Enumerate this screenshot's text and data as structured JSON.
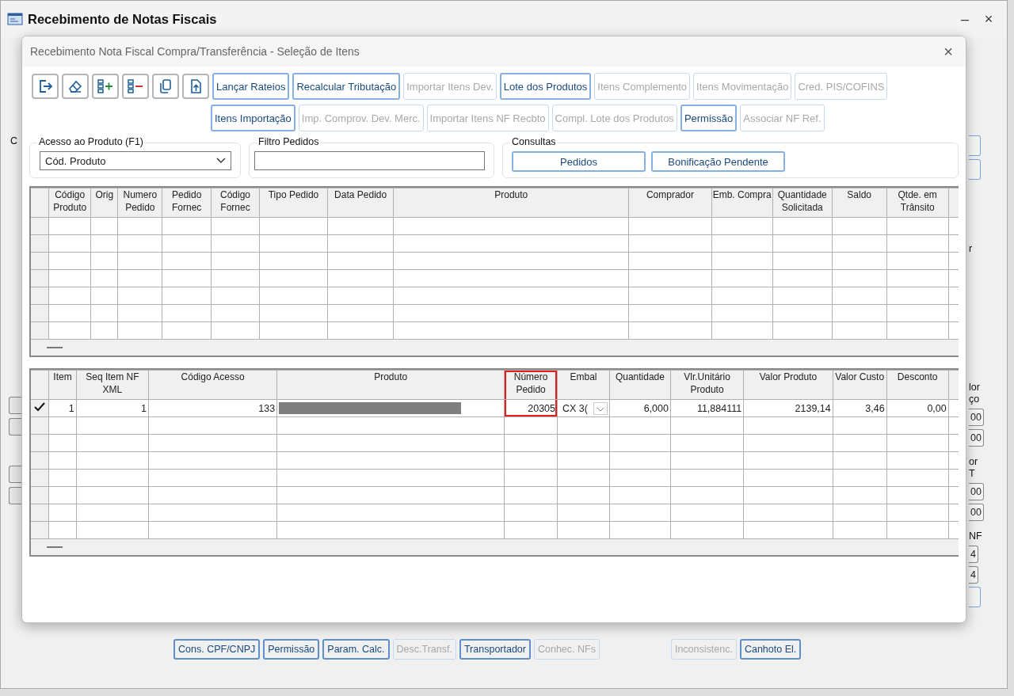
{
  "main_window": {
    "title": "Recebimento de Notas Fiscais",
    "controls": [
      "–",
      "×"
    ]
  },
  "background_left_label": "C",
  "background_right_fragments": [
    {
      "kind": "label",
      "text": "r"
    },
    {
      "kind": "label",
      "text": "lor"
    },
    {
      "kind": "label",
      "text": "ço"
    },
    {
      "kind": "field",
      "text": "00"
    },
    {
      "kind": "field",
      "text": "00"
    },
    {
      "kind": "label",
      "text": "or"
    },
    {
      "kind": "label",
      "text": "T"
    },
    {
      "kind": "field",
      "text": "00"
    },
    {
      "kind": "field",
      "text": "00"
    },
    {
      "kind": "label",
      "text": "NF"
    },
    {
      "kind": "field",
      "text": "4"
    },
    {
      "kind": "field",
      "text": "4"
    }
  ],
  "background_buttons_left": [
    {
      "label": "Cons. CPF/CNPJ",
      "disabled": false
    },
    {
      "label": "Permissão",
      "disabled": false
    },
    {
      "label": "Param. Calc.",
      "disabled": false
    },
    {
      "label": "Desc.Transf.",
      "disabled": true
    },
    {
      "label": "Transportador",
      "disabled": false
    },
    {
      "label": "Conhec. NFs",
      "disabled": true
    }
  ],
  "background_buttons_right": [
    {
      "label": "Inconsistenc.",
      "disabled": true
    },
    {
      "label": "Canhoto El.",
      "disabled": false
    }
  ],
  "dialog": {
    "title": "Recebimento Nota Fiscal Compra/Transferência - Seleção de Itens",
    "close": "×",
    "icon_buttons": [
      {
        "kind": "exit"
      },
      {
        "kind": "eraser"
      },
      {
        "kind": "add-row"
      },
      {
        "kind": "remove-row"
      },
      {
        "kind": "copy"
      },
      {
        "kind": "upload"
      }
    ],
    "toolbar_row_1": [
      {
        "label": "Lançar Rateios",
        "disabled": false
      },
      {
        "label": "Recalcular Tributação",
        "disabled": false
      },
      {
        "label": "Importar Itens Dev.",
        "disabled": true
      },
      {
        "label": "Lote dos Produtos",
        "disabled": false
      },
      {
        "label": "Itens Complemento",
        "disabled": true
      },
      {
        "label": "Itens Movimentação",
        "disabled": true
      },
      {
        "label": "Cred. PIS/COFINS",
        "disabled": true
      }
    ],
    "toolbar_row_2": [
      {
        "label": "Itens Importação",
        "disabled": false
      },
      {
        "label": "Imp. Comprov. Dev. Merc.",
        "disabled": true
      },
      {
        "label": "Importar Itens NF Recbto",
        "disabled": true
      },
      {
        "label": "Compl. Lote dos Produtos",
        "disabled": true
      },
      {
        "label": "Permissão",
        "disabled": false
      },
      {
        "label": "Associar NF Ref.",
        "disabled": true
      }
    ],
    "product_access": {
      "legend": "Acesso ao Produto (F1)",
      "value": "Cód. Produto"
    },
    "order_filter": {
      "legend": "Filtro Pedidos"
    },
    "queries": {
      "legend": "Consultas",
      "buttons": [
        "Pedidos",
        "Bonificação Pendente"
      ]
    },
    "orders_table": {
      "columns": [
        "Código Produto",
        "Orig",
        "Numero Pedido",
        "Pedido Fornec",
        "Código Fornec",
        "Tipo Pedido",
        "Data Pedido",
        "Produto",
        "Comprador",
        "Emb. Compra",
        "Quantidade Solicitada",
        "Saldo",
        "Qtde. em Trânsito"
      ]
    },
    "items_table": {
      "columns": [
        "Item",
        "Seq Item NF XML",
        "Código Acesso",
        "Produto",
        "Número Pedido",
        "Embal",
        "Quantidade",
        "Vlr.Unitário Produto",
        "Valor Produto",
        "Valor Custo",
        "Desconto"
      ],
      "rows": [
        {
          "current": true,
          "item": "1",
          "seq": "1",
          "access_code": "133",
          "order_number": "20305",
          "package": "CX 3(",
          "quantity": "6,000",
          "unit_value": "11,884111",
          "product_value": "2139,14",
          "cost_value": "3,46",
          "discount": "0,00",
          "highlighted": true
        }
      ]
    }
  }
}
